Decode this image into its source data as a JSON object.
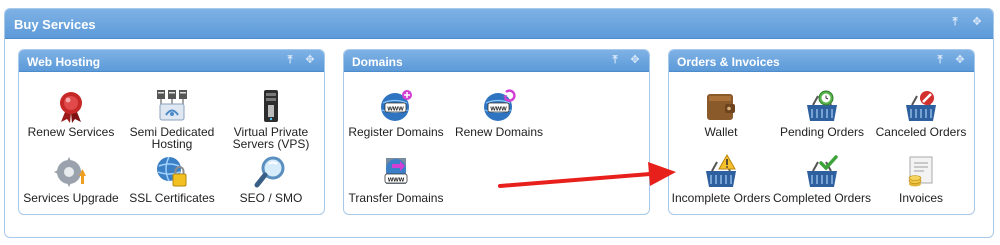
{
  "header": {
    "title": "Buy Services"
  },
  "panels": {
    "web_hosting": {
      "title": "Web Hosting",
      "items": [
        {
          "label": "Renew Services",
          "icon": "renew-badge-icon"
        },
        {
          "label": "Semi Dedicated Hosting",
          "icon": "server-rack-icon"
        },
        {
          "label": "Virtual Private Servers (VPS)",
          "icon": "server-tower-icon"
        },
        {
          "label": "Services Upgrade",
          "icon": "gear-upgrade-icon"
        },
        {
          "label": "SSL Certificates",
          "icon": "ssl-lock-icon"
        },
        {
          "label": "SEO / SMO",
          "icon": "magnifier-icon"
        }
      ]
    },
    "domains": {
      "title": "Domains",
      "items": [
        {
          "label": "Register Domains",
          "icon": "www-globe-add-icon"
        },
        {
          "label": "Renew Domains",
          "icon": "www-globe-renew-icon"
        },
        {
          "label": "Transfer Domains",
          "icon": "www-transfer-icon"
        }
      ]
    },
    "orders": {
      "title": "Orders & Invoices",
      "items": [
        {
          "label": "Wallet",
          "icon": "wallet-icon"
        },
        {
          "label": "Pending Orders",
          "icon": "basket-clock-icon"
        },
        {
          "label": "Canceled Orders",
          "icon": "basket-cancel-icon"
        },
        {
          "label": "Incomplete Orders",
          "icon": "basket-warning-icon"
        },
        {
          "label": "Completed Orders",
          "icon": "basket-check-icon"
        },
        {
          "label": "Invoices",
          "icon": "invoice-coins-icon"
        }
      ]
    }
  },
  "colors": {
    "header_blue": "#6aa4de",
    "panel_border": "#a9c9ea",
    "arrow_red": "#e8201c"
  }
}
